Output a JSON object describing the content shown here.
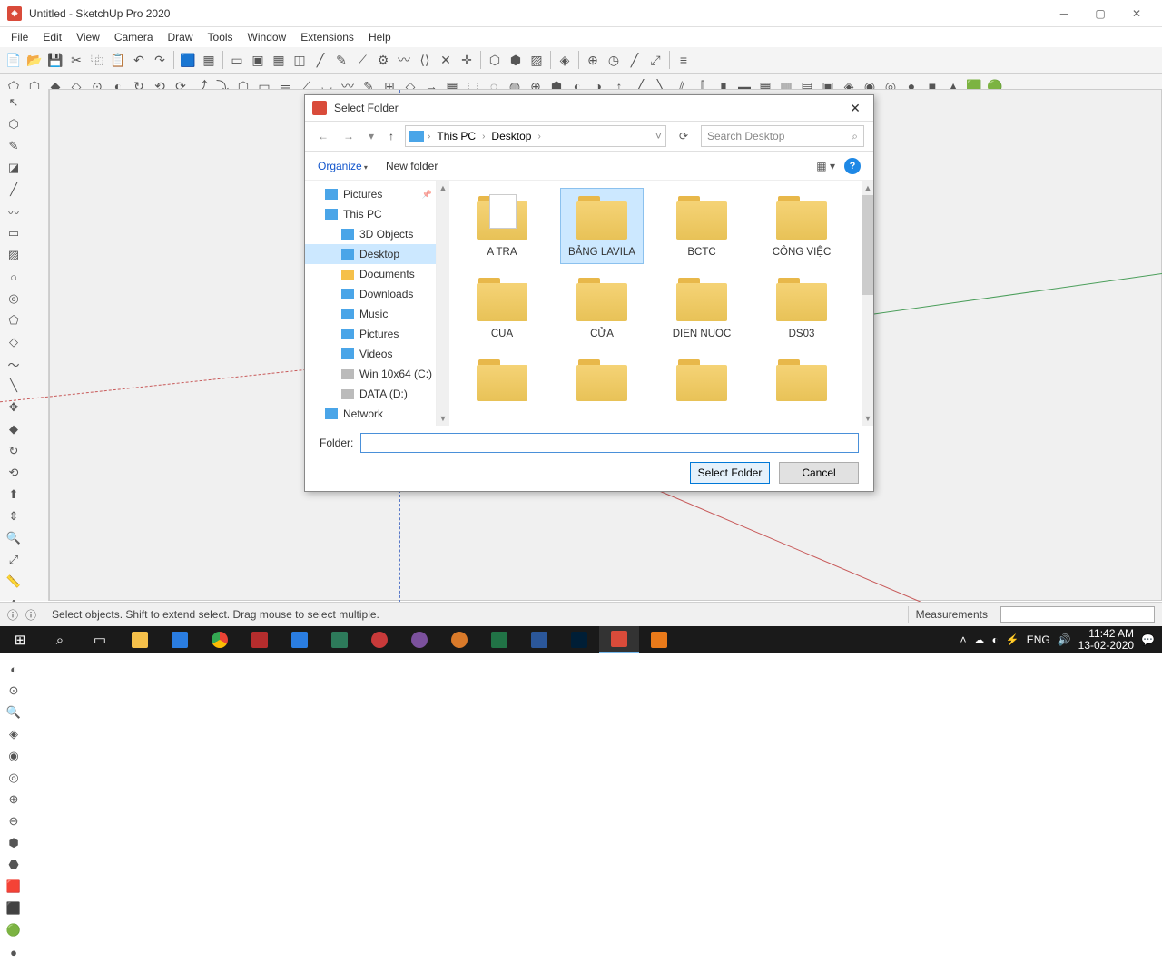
{
  "titlebar": {
    "title": "Untitled - SketchUp Pro 2020"
  },
  "menus": [
    "File",
    "Edit",
    "View",
    "Camera",
    "Draw",
    "Tools",
    "Window",
    "Extensions",
    "Help"
  ],
  "statusbar": {
    "help": "Select objects. Shift to extend select. Drag mouse to select multiple.",
    "meas_label": "Measurements"
  },
  "dialog": {
    "title": "Select Folder",
    "breadcrumb": [
      "This PC",
      "Desktop"
    ],
    "search_placeholder": "Search Desktop",
    "organize": "Organize",
    "newfolder": "New folder",
    "tree": [
      {
        "label": "Pictures",
        "icon": "blue",
        "pin": true
      },
      {
        "label": "This PC",
        "icon": "blue",
        "indent": 0
      },
      {
        "label": "3D Objects",
        "icon": "blue",
        "indent": 1
      },
      {
        "label": "Desktop",
        "icon": "blue",
        "indent": 1,
        "selected": true
      },
      {
        "label": "Documents",
        "icon": "fold",
        "indent": 1
      },
      {
        "label": "Downloads",
        "icon": "blue",
        "indent": 1
      },
      {
        "label": "Music",
        "icon": "blue",
        "indent": 1
      },
      {
        "label": "Pictures",
        "icon": "blue",
        "indent": 1
      },
      {
        "label": "Videos",
        "icon": "blue",
        "indent": 1
      },
      {
        "label": "Win 10x64 (C:)",
        "icon": "disk",
        "indent": 1
      },
      {
        "label": "DATA (D:)",
        "icon": "disk",
        "indent": 1
      },
      {
        "label": "Network",
        "icon": "blue",
        "indent": 0
      }
    ],
    "folders": [
      {
        "name": "A TRA",
        "open": true
      },
      {
        "name": "BẢNG LAVILA",
        "selected": true
      },
      {
        "name": "BCTC"
      },
      {
        "name": "CÔNG VIỆC"
      },
      {
        "name": "CUA"
      },
      {
        "name": "CỬA"
      },
      {
        "name": "DIEN NUOC"
      },
      {
        "name": "DS03"
      },
      {
        "name": "",
        "partial": true
      },
      {
        "name": "",
        "partial": true
      },
      {
        "name": "",
        "partial": true
      },
      {
        "name": "",
        "partial": true
      }
    ],
    "folder_label": "Folder:",
    "folder_value": "",
    "select_btn": "Select Folder",
    "cancel_btn": "Cancel"
  },
  "tray": {
    "time": "11:42 AM",
    "date": "13-02-2020"
  }
}
